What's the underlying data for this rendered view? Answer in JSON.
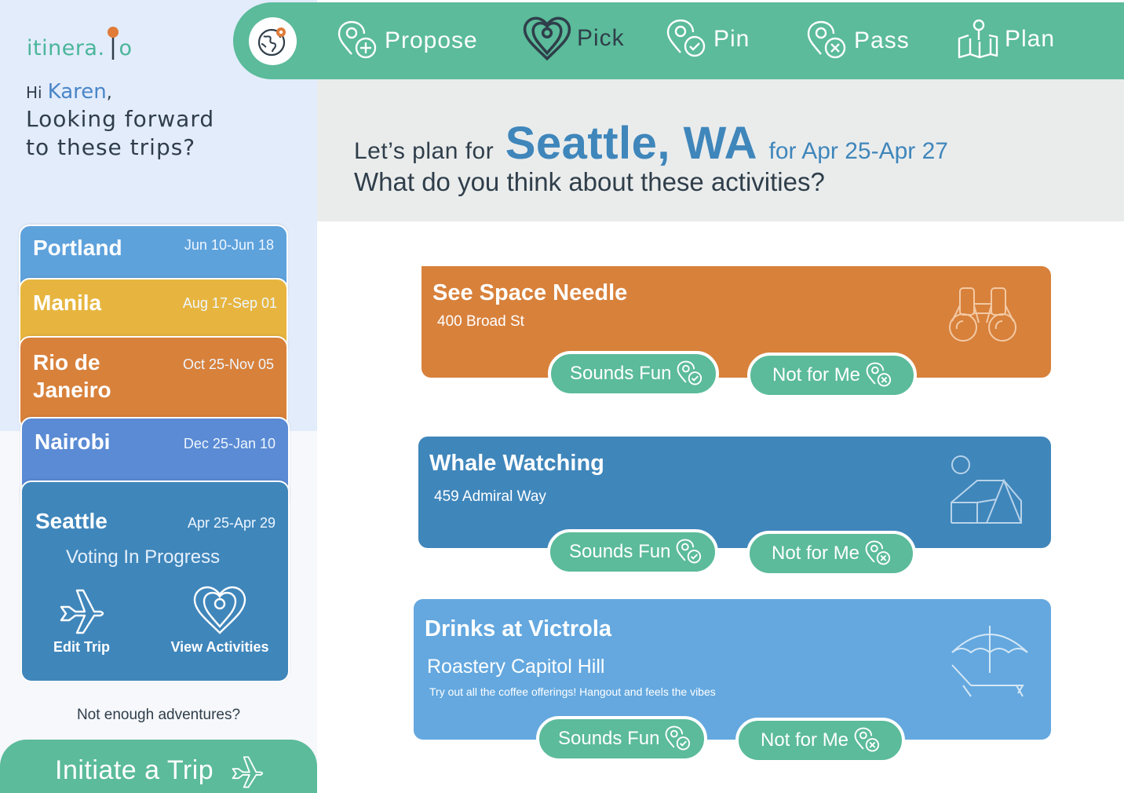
{
  "brand": {
    "logo_text": "itinera.",
    "logo_suffix": "o",
    "accent": "#5bbb9a",
    "pin_color": "#e07b39"
  },
  "greeting": {
    "hi": "Hi",
    "name": "Karen",
    "comma": ",",
    "message": "Looking forward to these trips?"
  },
  "trips": [
    {
      "name": "Portland",
      "dates": "Jun 10-Jun 18",
      "color": "#5ea2dc"
    },
    {
      "name": "Manila",
      "dates": "Aug 17-Sep 01",
      "color": "#e7b53f"
    },
    {
      "name": "Rio de Janeiro",
      "dates": "Oct 25-Nov 05",
      "color": "#d8813b"
    },
    {
      "name": "Nairobi",
      "dates": "Dec 25-Jan 10",
      "color": "#5a8bd4"
    },
    {
      "name": "Seattle",
      "dates": "Apr 25-Apr 29",
      "status": "Voting In Progress",
      "edit_label": "Edit Trip",
      "view_label": "View Activities",
      "color": "#3f86bb"
    }
  ],
  "sidebar_footer": {
    "prompt": "Not enough adventures?",
    "cta_label": "Initiate a Trip",
    "cta_icon": "plane-icon"
  },
  "nav": {
    "home_icon": "globe-pin-icon",
    "items": [
      {
        "label": "Propose",
        "icon": "pin-plus-icon"
      },
      {
        "label": "Pick",
        "icon": "heart-pin-icon"
      },
      {
        "label": "Pin",
        "icon": "pin-check-icon"
      },
      {
        "label": "Pass",
        "icon": "pin-x-icon"
      },
      {
        "label": "Plan",
        "icon": "map-pin-icon"
      }
    ]
  },
  "plan_header": {
    "prefix": "Let’s plan for",
    "city": "Seattle, WA",
    "dates": "for Apr 25-Apr 27",
    "question": "What do you think about these activities?"
  },
  "activities": [
    {
      "title": "See Space Needle",
      "address": "400 Broad St",
      "description": "",
      "icon": "binoculars-icon",
      "color": "#d8813b",
      "yes_label": "Sounds Fun",
      "no_label": "Not for Me"
    },
    {
      "title": "Whale Watching",
      "address": "459 Admiral Way",
      "description": "",
      "icon": "camping-icon",
      "color": "#3f86bb",
      "yes_label": "Sounds Fun",
      "no_label": "Not for Me"
    },
    {
      "title": "Drinks at Victrola",
      "address": "Roastery Capitol Hill",
      "description": "Try out all the coffee offerings!  Hangout and feels the vibes",
      "icon": "beach-chair-icon",
      "color": "#64a8df",
      "yes_label": "Sounds Fun",
      "no_label": "Not for Me"
    }
  ]
}
